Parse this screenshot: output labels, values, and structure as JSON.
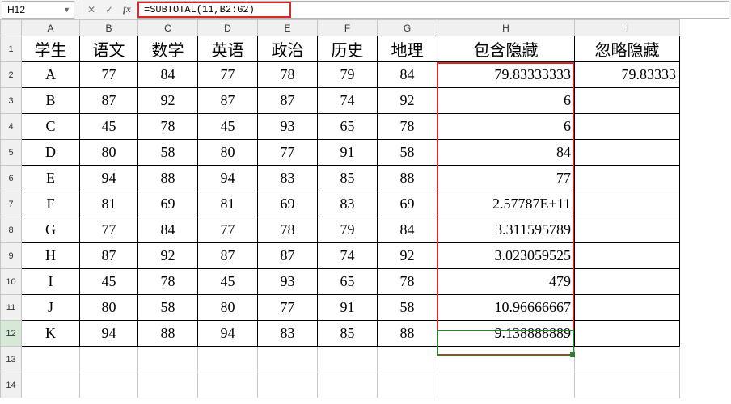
{
  "formula_bar": {
    "name_box_value": "H12",
    "formula": "=SUBTOTAL(11,B2:G2)"
  },
  "columns": [
    "A",
    "B",
    "C",
    "D",
    "E",
    "F",
    "G",
    "H",
    "I"
  ],
  "row_numbers": [
    "1",
    "2",
    "3",
    "4",
    "5",
    "6",
    "7",
    "8",
    "9",
    "10",
    "11",
    "12",
    "13",
    "14"
  ],
  "header_row": {
    "A": "学生",
    "B": "语文",
    "C": "数学",
    "D": "英语",
    "E": "政治",
    "F": "历史",
    "G": "地理",
    "H": "包含隐藏",
    "I": "忽略隐藏"
  },
  "rows": [
    {
      "A": "A",
      "B": "77",
      "C": "84",
      "D": "77",
      "E": "78",
      "F": "79",
      "G": "84",
      "H": "79.83333333",
      "I": "79.83333"
    },
    {
      "A": "B",
      "B": "87",
      "C": "92",
      "D": "87",
      "E": "87",
      "F": "74",
      "G": "92",
      "H": "6",
      "I": ""
    },
    {
      "A": "C",
      "B": "45",
      "C": "78",
      "D": "45",
      "E": "93",
      "F": "65",
      "G": "78",
      "H": "6",
      "I": ""
    },
    {
      "A": "D",
      "B": "80",
      "C": "58",
      "D": "80",
      "E": "77",
      "F": "91",
      "G": "58",
      "H": "84",
      "I": ""
    },
    {
      "A": "E",
      "B": "94",
      "C": "88",
      "D": "94",
      "E": "83",
      "F": "85",
      "G": "88",
      "H": "77",
      "I": ""
    },
    {
      "A": "F",
      "B": "81",
      "C": "69",
      "D": "81",
      "E": "69",
      "F": "83",
      "G": "69",
      "H": "2.57787E+11",
      "I": ""
    },
    {
      "A": "G",
      "B": "77",
      "C": "84",
      "D": "77",
      "E": "78",
      "F": "79",
      "G": "84",
      "H": "3.311595789",
      "I": ""
    },
    {
      "A": "H",
      "B": "87",
      "C": "92",
      "D": "87",
      "E": "87",
      "F": "74",
      "G": "92",
      "H": "3.023059525",
      "I": ""
    },
    {
      "A": "I",
      "B": "45",
      "C": "78",
      "D": "45",
      "E": "93",
      "F": "65",
      "G": "78",
      "H": "479",
      "I": ""
    },
    {
      "A": "J",
      "B": "80",
      "C": "58",
      "D": "80",
      "E": "77",
      "F": "91",
      "G": "58",
      "H": "10.96666667",
      "I": ""
    },
    {
      "A": "K",
      "B": "94",
      "C": "88",
      "D": "94",
      "E": "83",
      "F": "85",
      "G": "88",
      "H": "9.138888889",
      "I": ""
    }
  ]
}
